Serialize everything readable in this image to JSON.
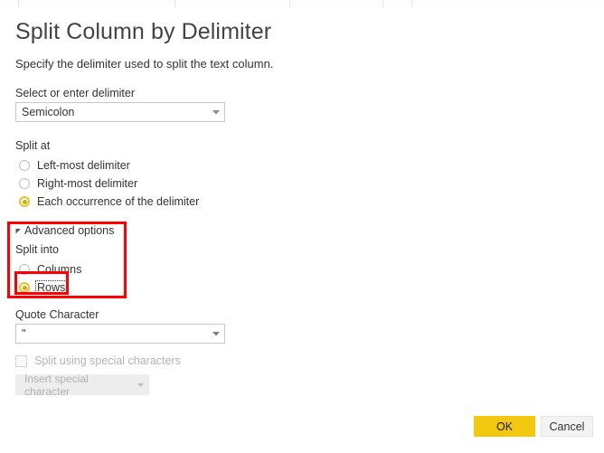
{
  "window": {
    "close_icon": "close-icon"
  },
  "dialog": {
    "title": "Split Column by Delimiter",
    "subtitle": "Specify the delimiter used to split the text column."
  },
  "delimiter": {
    "label": "Select or enter delimiter",
    "value": "Semicolon",
    "caret_icon": "chevron-down-icon"
  },
  "split_at": {
    "label": "Split at",
    "options": [
      {
        "label": "Left-most delimiter",
        "checked": false
      },
      {
        "label": "Right-most delimiter",
        "checked": false
      },
      {
        "label": "Each occurrence of the delimiter",
        "checked": true
      }
    ]
  },
  "advanced": {
    "label": "Advanced options",
    "expanded": true,
    "triangle_icon": "triangle-expanded-icon",
    "split_into": {
      "label": "Split into",
      "options": [
        {
          "label": "Columns",
          "checked": false
        },
        {
          "label": "Rows",
          "checked": true,
          "focused": true
        }
      ]
    }
  },
  "quote_character": {
    "label": "Quote Character",
    "value": "\"",
    "caret_icon": "chevron-down-icon"
  },
  "special_characters": {
    "checkbox_label": "Split using special characters",
    "checked": false,
    "enabled": false,
    "insert_button_label": "Insert special character",
    "insert_button_caret_icon": "chevron-down-icon"
  },
  "footer": {
    "ok_label": "OK",
    "cancel_label": "Cancel"
  },
  "colors": {
    "accent_yellow": "#f2c811",
    "radio_selected_ring": "#e8c22b",
    "radio_selected_dot": "#d9a800",
    "annotation_red": "#ff0000",
    "text": "#333333",
    "disabled_text": "#b4b4b4"
  }
}
